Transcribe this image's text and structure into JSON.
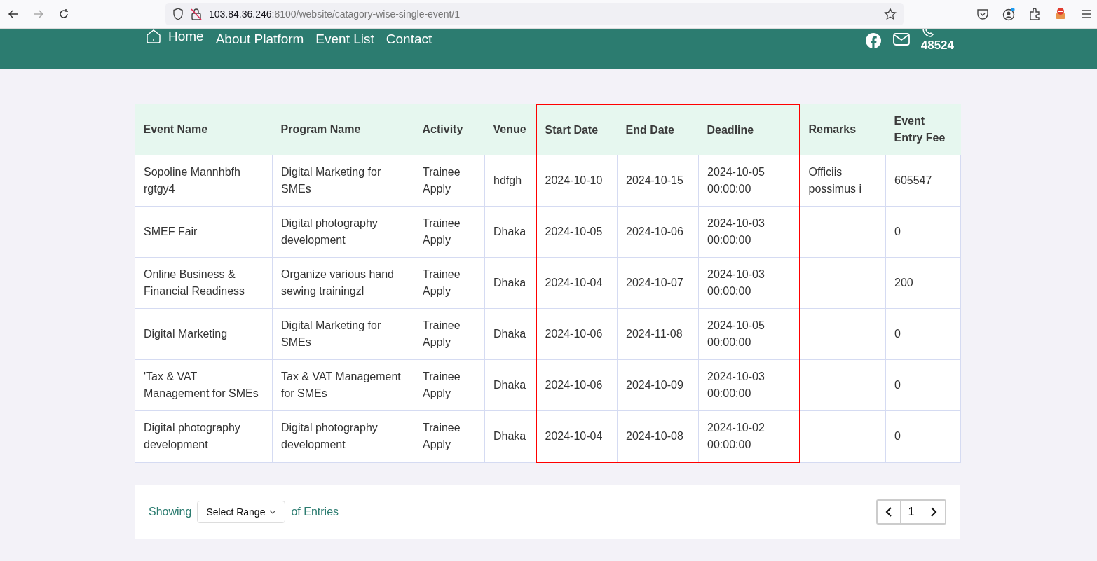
{
  "browser": {
    "url_host": "103.84.36.246",
    "url_path": ":8100/website/catagory-wise-single-event/1"
  },
  "nav": {
    "items": [
      {
        "label": "Home",
        "kind": "home"
      },
      {
        "label": "About Platform",
        "kind": "link"
      },
      {
        "label": "Event List",
        "kind": "link"
      },
      {
        "label": "Contact",
        "kind": "link"
      }
    ],
    "phone": "48524"
  },
  "table": {
    "columns": [
      {
        "label": "Event Name",
        "highlighted": false
      },
      {
        "label": "Program Name",
        "highlighted": false
      },
      {
        "label": "Activity",
        "highlighted": false
      },
      {
        "label": "Venue",
        "highlighted": false
      },
      {
        "label": "Start Date",
        "highlighted": true
      },
      {
        "label": "End Date",
        "highlighted": true
      },
      {
        "label": "Deadline",
        "highlighted": true
      },
      {
        "label": "Remarks",
        "highlighted": false
      },
      {
        "label": "Event Entry Fee",
        "highlighted": false
      }
    ],
    "rows": [
      [
        "Sopoline Mannhbfh rgtgy4",
        "Digital Marketing for SMEs",
        "Trainee Apply",
        "hdfgh",
        "2024-10-10",
        "2024-10-15",
        "2024-10-05 00:00:00",
        "Officiis possimus i",
        "605547"
      ],
      [
        "SMEF Fair",
        "Digital photography development",
        "Trainee Apply",
        "Dhaka",
        "2024-10-05",
        "2024-10-06",
        "2024-10-03 00:00:00",
        "",
        "0"
      ],
      [
        "Online Business & Financial Readiness",
        "Organize various hand sewing trainingzl",
        "Trainee Apply",
        "Dhaka",
        "2024-10-04",
        "2024-10-07",
        "2024-10-03 00:00:00",
        "",
        "200"
      ],
      [
        "Digital Marketing",
        "Digital Marketing for SMEs",
        "Trainee Apply",
        "Dhaka",
        "2024-10-06",
        "2024-11-08",
        "2024-10-05 00:00:00",
        "",
        "0"
      ],
      [
        "'Tax & VAT Management for SMEs",
        "Tax & VAT Management for SMEs",
        "Trainee Apply",
        "Dhaka",
        "2024-10-06",
        "2024-10-09",
        "2024-10-03 00:00:00",
        "",
        "0"
      ],
      [
        "Digital photography development",
        "Digital photography development",
        "Trainee Apply",
        "Dhaka",
        "2024-10-04",
        "2024-10-08",
        "2024-10-02 00:00:00",
        "",
        "0"
      ]
    ]
  },
  "footer": {
    "showing": "Showing",
    "range_select": "Select Range",
    "of_entries": "of Entries",
    "page": "1"
  }
}
